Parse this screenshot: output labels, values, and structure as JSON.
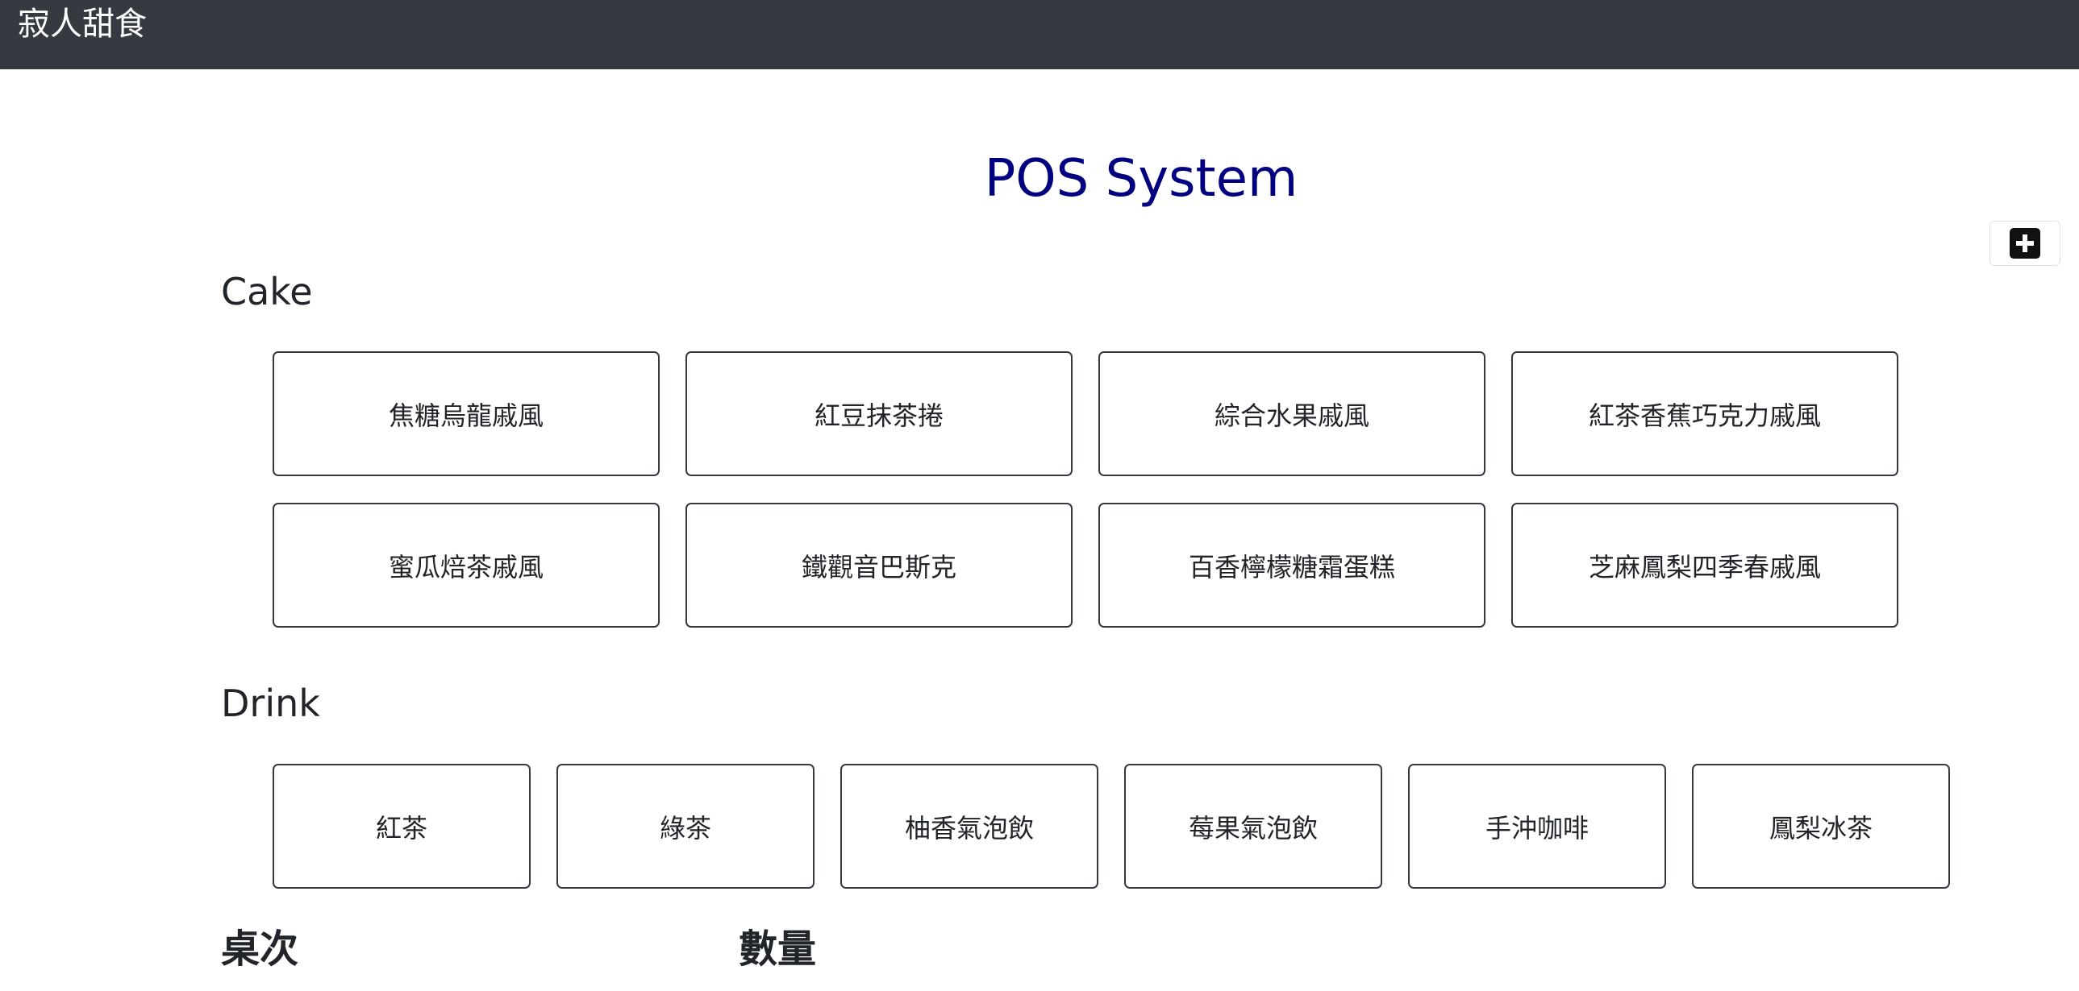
{
  "navbar": {
    "brand": "寂人甜食"
  },
  "page": {
    "title": "POS System"
  },
  "toolbar": {
    "add_icon": "plus-square-icon"
  },
  "sections": {
    "cake": {
      "heading": "Cake",
      "items": [
        "焦糖烏龍戚風",
        "紅豆抹茶捲",
        "綜合水果戚風",
        "紅茶香蕉巧克力戚風",
        "蜜瓜焙茶戚風",
        "鐵觀音巴斯克",
        "百香檸檬糖霜蛋糕",
        "芝麻鳳梨四季春戚風"
      ]
    },
    "drink": {
      "heading": "Drink",
      "items": [
        "紅茶",
        "綠茶",
        "柚香氣泡飲",
        "莓果氣泡飲",
        "手沖咖啡",
        "鳳梨冰茶"
      ]
    }
  },
  "order": {
    "table_label": "桌次",
    "quantity_label": "數量"
  }
}
